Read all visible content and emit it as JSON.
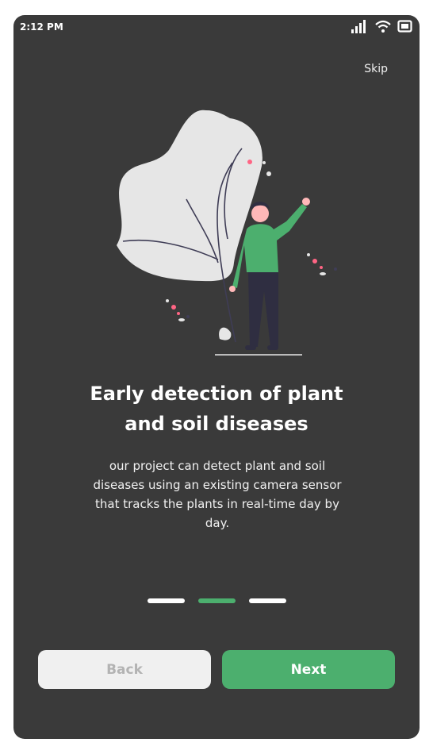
{
  "status": {
    "time": "2:12 PM"
  },
  "header": {
    "skip_label": "Skip"
  },
  "onboarding": {
    "title_line1": "Early detection of plant",
    "title_line2": "and soil diseases",
    "description": "our project can detect plant and soil diseases using an existing camera sensor that tracks the plants in real-time day by day.",
    "pager": {
      "total": 3,
      "active_index": 1
    }
  },
  "buttons": {
    "back_label": "Back",
    "next_label": "Next"
  },
  "colors": {
    "background": "#3a3a3a",
    "accent": "#4caf6e",
    "light": "#f0f0f0"
  },
  "icons": [
    "signal-icon",
    "wifi-icon",
    "battery-icon"
  ]
}
